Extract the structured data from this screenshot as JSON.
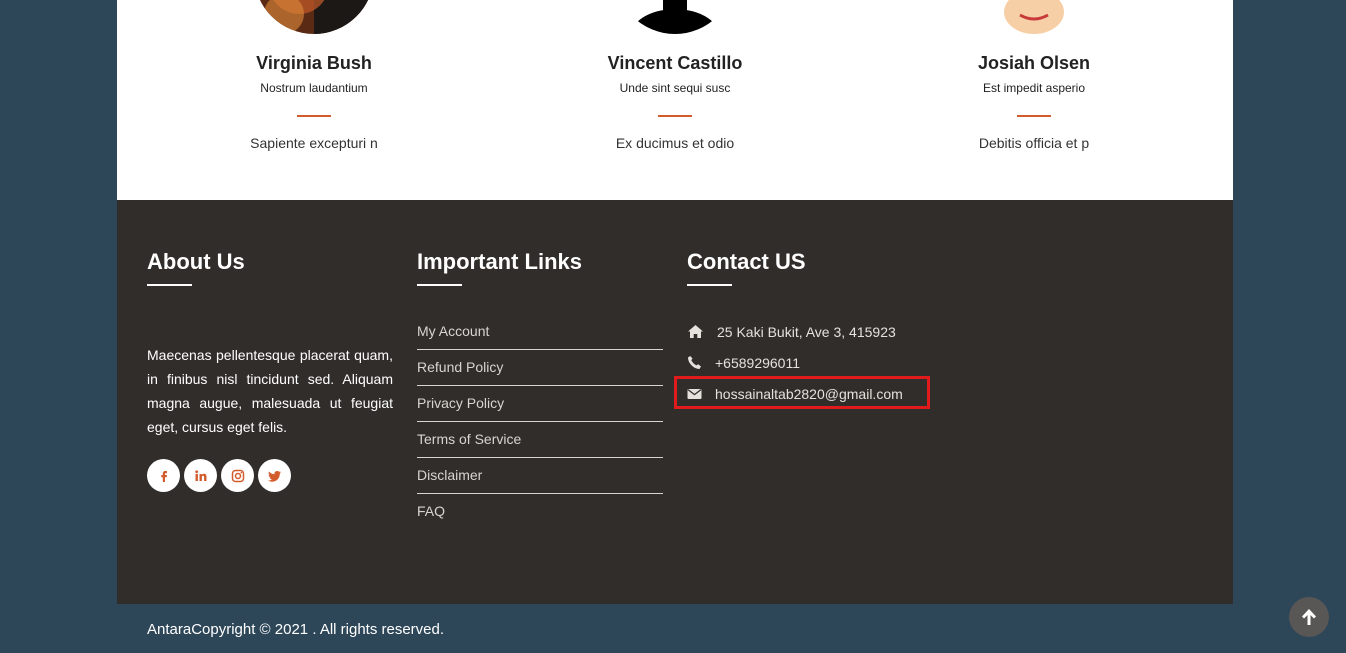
{
  "team": [
    {
      "name": "Virginia Bush",
      "role": "Nostrum laudantium",
      "bio": "Sapiente excepturi n"
    },
    {
      "name": "Vincent Castillo",
      "role": "Unde sint sequi susc",
      "bio": "Ex ducimus et odio"
    },
    {
      "name": "Josiah Olsen",
      "role": "Est impedit asperio",
      "bio": "Debitis officia et p"
    }
  ],
  "footer": {
    "about": {
      "title": "About Us",
      "text": "Maecenas pellentesque placerat quam, in finibus nisl tincidunt sed. Aliquam magna augue, malesuada ut feugiat eget, cursus eget felis."
    },
    "links": {
      "title": "Important Links",
      "items": [
        "My Account",
        "Refund Policy",
        "Privacy Policy",
        "Terms of Service",
        "Disclaimer",
        "FAQ"
      ]
    },
    "contact": {
      "title": "Contact US",
      "address": "25 Kaki Bukit, Ave 3, 415923",
      "phone": "+6589296011",
      "email": "hossainaltab2820@gmail.com"
    },
    "socials": [
      "facebook-icon",
      "linkedin-icon",
      "instagram-icon",
      "twitter-icon"
    ]
  },
  "copyright": "AntaraCopyright © 2021 . All rights reserved.",
  "colors": {
    "accent": "#d35c2c",
    "footer_bg": "#312d2a",
    "page_bg": "#2d4658",
    "highlight": "#e11b1b"
  }
}
